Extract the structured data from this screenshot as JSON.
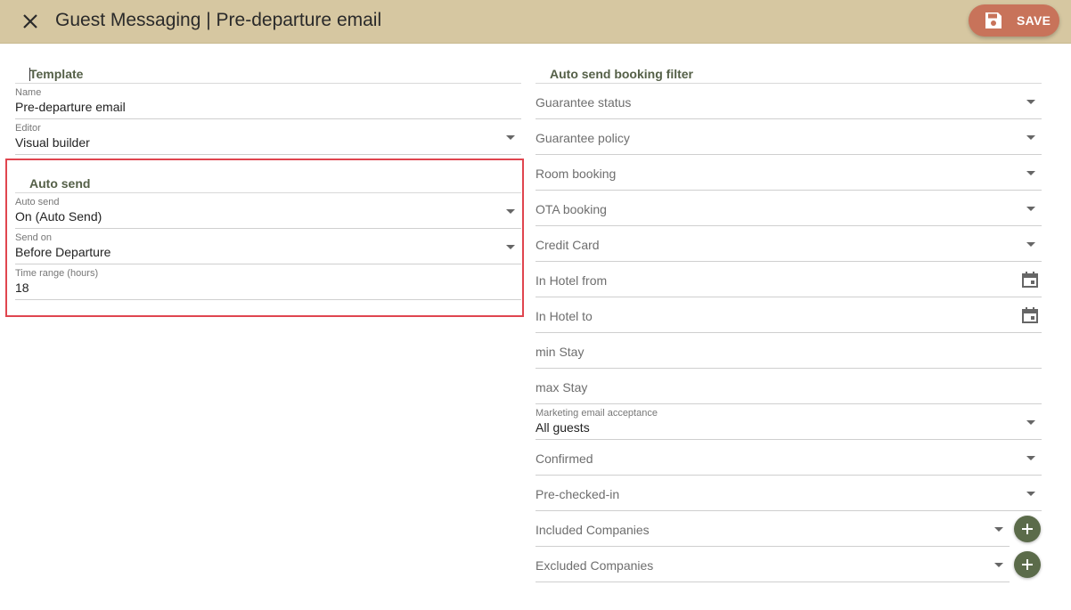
{
  "header": {
    "title": "Guest Messaging | Pre-departure email",
    "save_label": "SAVE",
    "colors": {
      "bar": "#d6c7a1",
      "save": "#c8735a"
    }
  },
  "left": {
    "template_title": "Template",
    "name": {
      "label": "Name",
      "value": "Pre-departure email"
    },
    "editor": {
      "label": "Editor",
      "value": "Visual builder"
    },
    "auto_send_title": "Auto send",
    "auto_send": {
      "label": "Auto send",
      "value": "On (Auto Send)"
    },
    "send_on": {
      "label": "Send on",
      "value": "Before Departure"
    },
    "time_range": {
      "label": "Time range (hours)",
      "value": "18"
    }
  },
  "right": {
    "filter_title": "Auto send booking filter",
    "fields": {
      "guarantee_status": "Guarantee status",
      "guarantee_policy": "Guarantee policy",
      "room_booking": "Room booking",
      "ota_booking": "OTA booking",
      "credit_card": "Credit Card",
      "in_hotel_from": "In Hotel from",
      "in_hotel_to": "In Hotel to",
      "min_stay": "min Stay",
      "max_stay": "max Stay",
      "marketing_label": "Marketing email acceptance",
      "marketing_value": "All guests",
      "confirmed": "Confirmed",
      "pre_checked_in": "Pre-checked-in",
      "included_companies": "Included Companies",
      "excluded_companies": "Excluded Companies"
    }
  },
  "icons": {
    "close": "close-icon",
    "save": "floppy-disk-icon",
    "dropdown": "chevron-down-icon",
    "calendar": "calendar-icon",
    "add": "plus-icon"
  },
  "accent_colors": {
    "highlight_border": "#e0454f",
    "add_button": "#5b6b4a",
    "section_title": "#556048"
  }
}
